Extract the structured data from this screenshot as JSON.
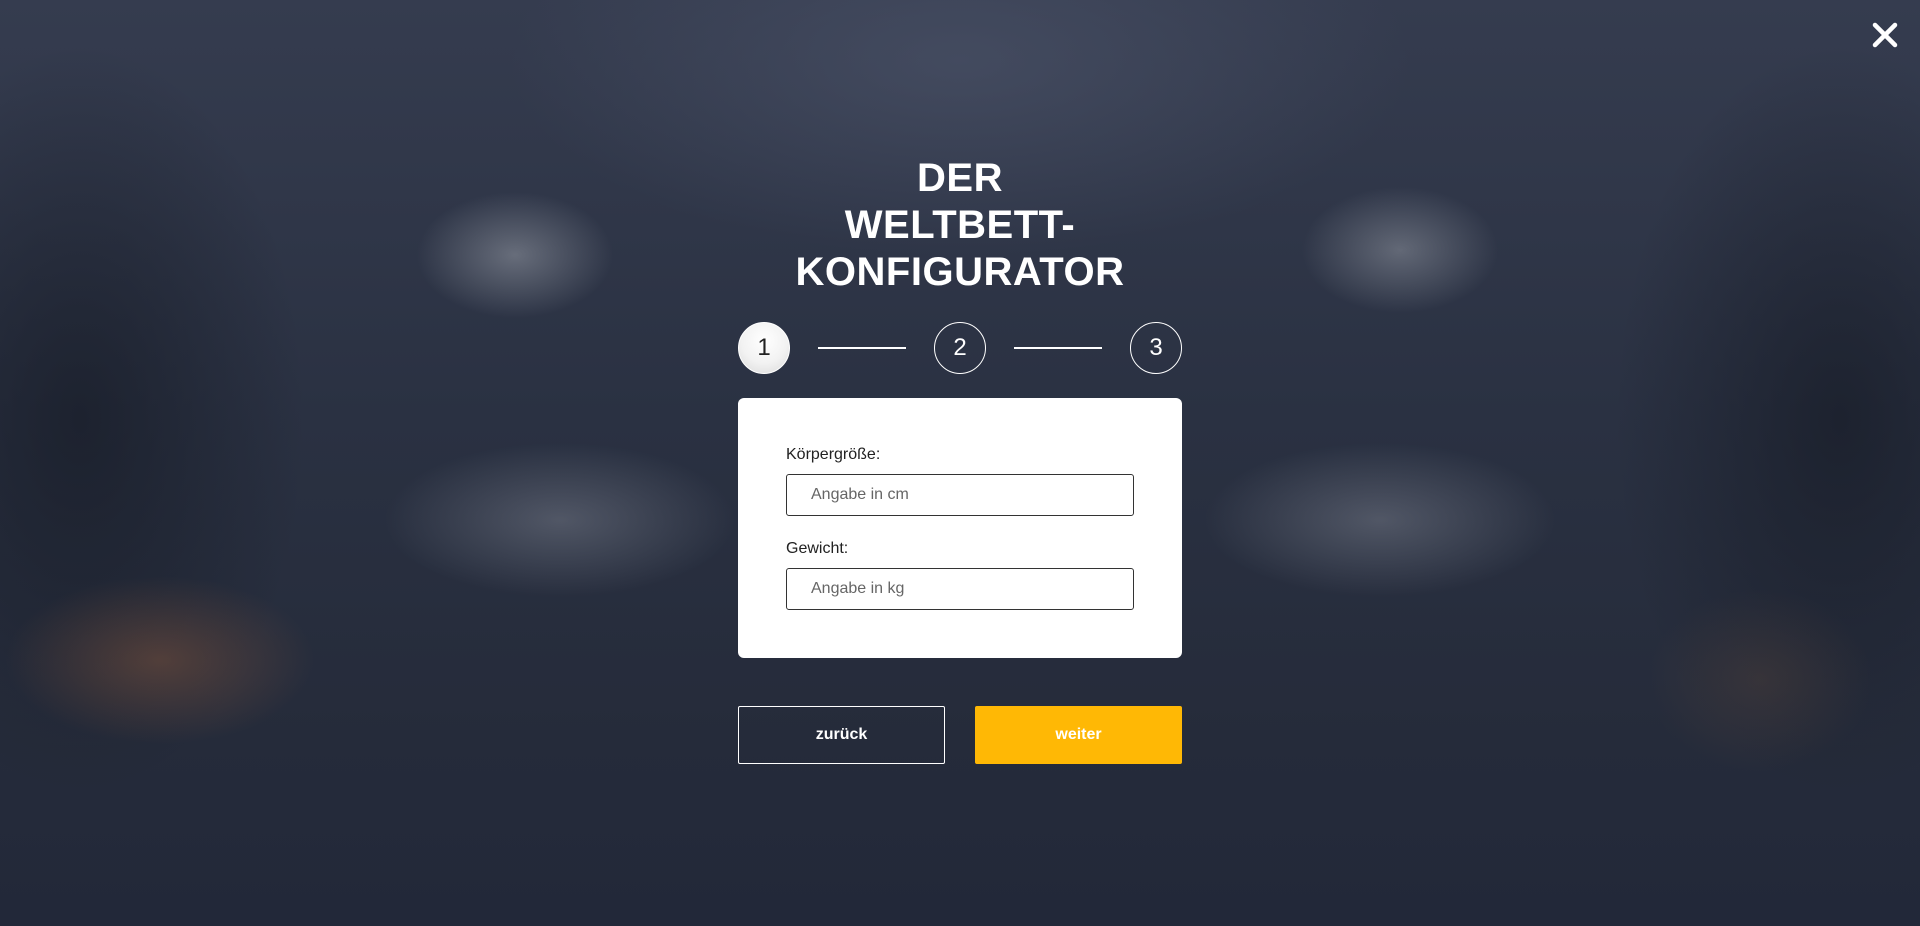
{
  "header": {
    "title_lines": [
      "DER",
      "WELTBETT-",
      "KONFIGURATOR"
    ],
    "close_icon": "close-icon"
  },
  "steps": [
    {
      "label": "1",
      "active": true
    },
    {
      "label": "2",
      "active": false
    },
    {
      "label": "3",
      "active": false
    }
  ],
  "form": {
    "height": {
      "label": "Körpergröße:",
      "placeholder": "Angabe in cm",
      "value": ""
    },
    "weight": {
      "label": "Gewicht:",
      "placeholder": "Angabe in kg",
      "value": ""
    }
  },
  "actions": {
    "back_label": "zurück",
    "next_label": "weiter"
  },
  "colors": {
    "accent": "#ffb805",
    "background": "#262d3e",
    "card": "#ffffff"
  }
}
